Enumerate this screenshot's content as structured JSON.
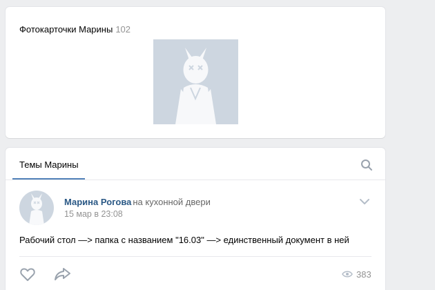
{
  "photos": {
    "title": "Фотокарточки Марины",
    "count": "102"
  },
  "wall": {
    "tab_label": "Темы Марины"
  },
  "post": {
    "author_name": "Марина Рогова",
    "author_suffix": "на кухонной двери",
    "date": "15 мар в 23:08",
    "text": "Рабочий стол —> папка с названием \"16.03\" —> единственный документ в ней",
    "views": "383"
  },
  "colors": {
    "accent": "#5181b8",
    "link": "#2a5885",
    "muted": "#939393",
    "page_bg": "#edeef0",
    "placeholder": "#cdd6e0"
  },
  "icons": {
    "search": "search-icon",
    "like": "heart-icon",
    "share": "share-arrow-icon",
    "menu": "chevron-down-icon",
    "views": "eye-icon"
  }
}
